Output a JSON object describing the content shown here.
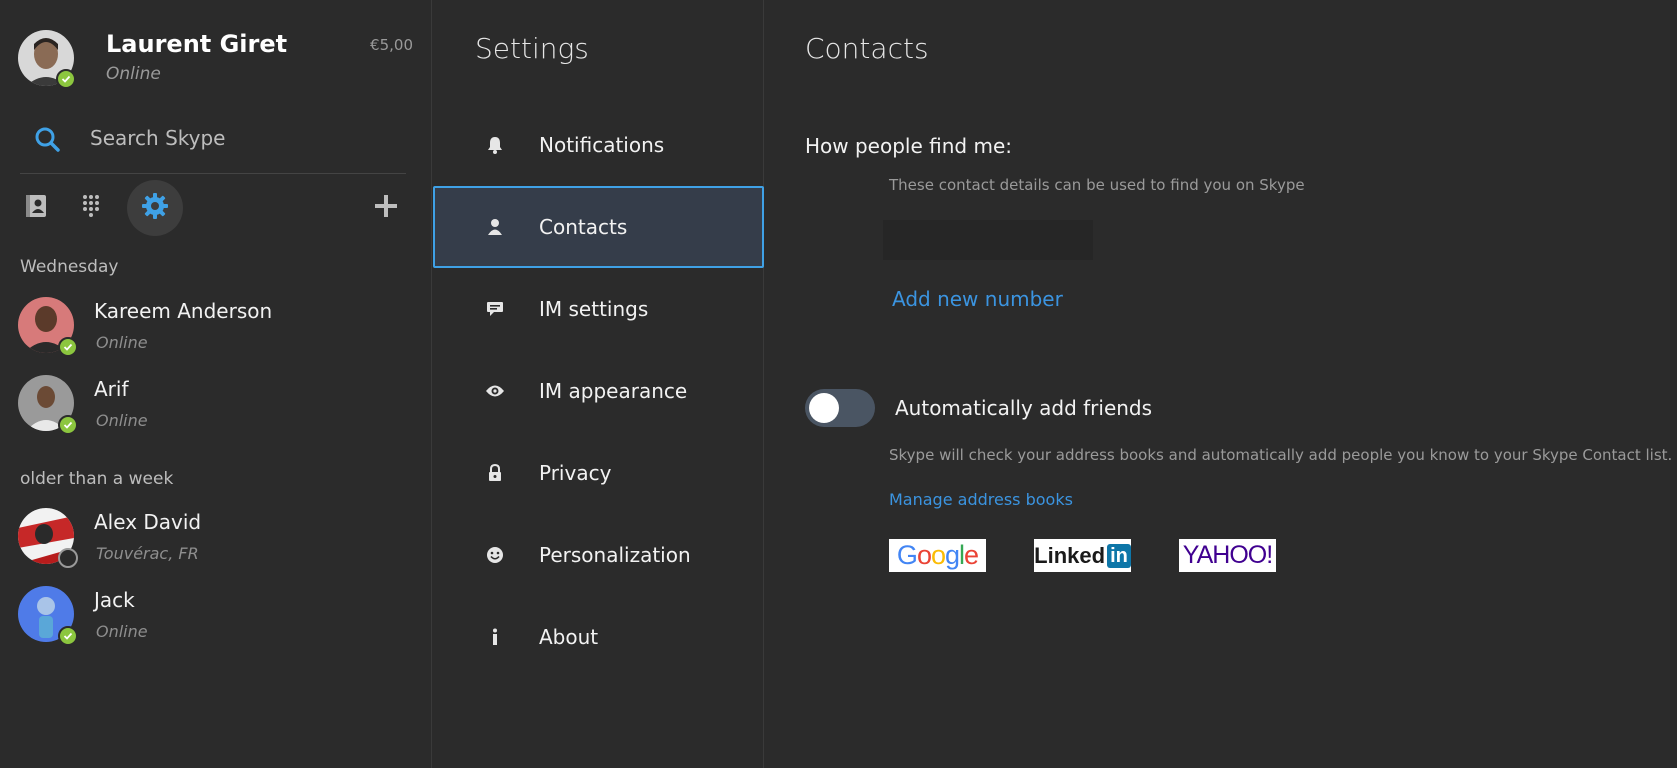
{
  "profile": {
    "name": "Laurent Giret",
    "status": "Online",
    "credit": "€5,00"
  },
  "search": {
    "placeholder": "Search Skype"
  },
  "toolbar": {
    "items": [
      "contacts-book-icon",
      "dialpad-icon",
      "settings-gear-icon"
    ],
    "active": "settings-gear-icon",
    "add_icon": "plus-icon"
  },
  "recent": {
    "sections": [
      {
        "heading": "Wednesday",
        "contacts": [
          {
            "name": "Kareem Anderson",
            "status": "Online",
            "presence": "online"
          },
          {
            "name": "Arif",
            "status": "Online",
            "presence": "online"
          }
        ]
      },
      {
        "heading": "older than a week",
        "contacts": [
          {
            "name": "Alex David",
            "status": "Touvérac, FR",
            "presence": "offline"
          },
          {
            "name": "Jack",
            "status": "Online",
            "presence": "online"
          }
        ]
      }
    ]
  },
  "settings": {
    "title": "Settings",
    "items": [
      {
        "label": "Notifications",
        "icon": "bell-icon"
      },
      {
        "label": "Contacts",
        "icon": "person-icon",
        "active": true
      },
      {
        "label": "IM settings",
        "icon": "chat-bubble-icon"
      },
      {
        "label": "IM appearance",
        "icon": "eye-icon"
      },
      {
        "label": "Privacy",
        "icon": "lock-icon"
      },
      {
        "label": "Personalization",
        "icon": "smiley-icon"
      },
      {
        "label": "About",
        "icon": "info-icon"
      }
    ]
  },
  "contacts_page": {
    "title": "Contacts",
    "find_heading": "How people find me:",
    "find_desc": "These contact details can be used to find you on Skype",
    "number_value": "",
    "add_number": "Add new number",
    "auto_add_label": "Automatically add friends",
    "auto_add_enabled": false,
    "auto_add_desc": "Skype will check your address books and automatically add people you know to your Skype Contact list.",
    "manage_link": "Manage address books",
    "providers": [
      "Google",
      "Linked",
      "in",
      "YAHOO!"
    ]
  },
  "colors": {
    "background": "#2b2b2b",
    "accent": "#3fa1e6",
    "link": "#3b94e0",
    "online": "#8cc63f",
    "active_item": "#353d4a"
  }
}
